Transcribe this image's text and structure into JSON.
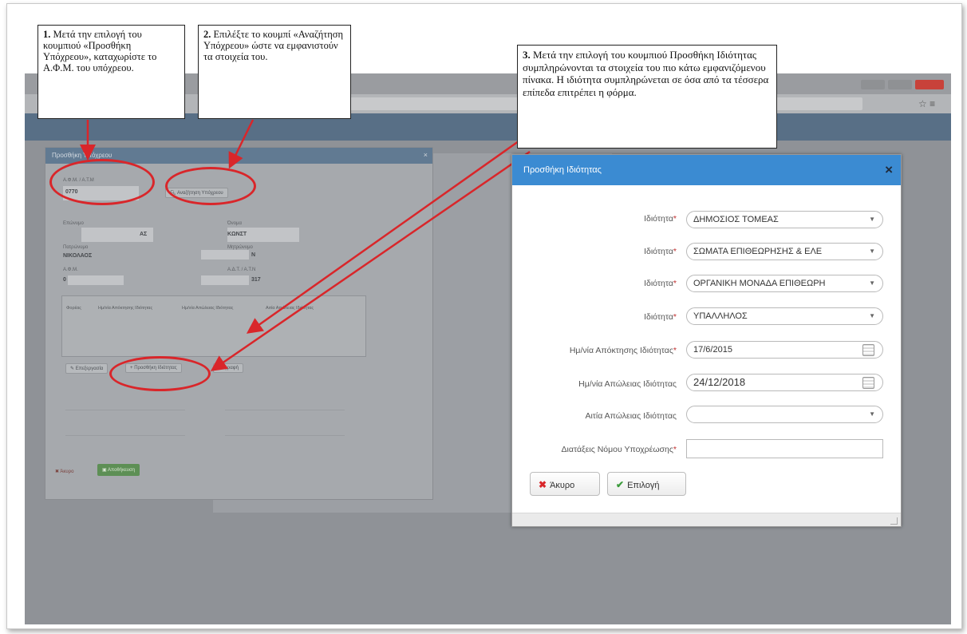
{
  "callouts": {
    "c1_num": "1.",
    "c1_text": "Μετά την επιλογή του κουμπιού «Προσθήκη Υπόχρεου», καταχωρίστε το Α.Φ.Μ. του υπόχρεου.",
    "c2_num": "2.",
    "c2_text": "Επιλέξτε το κουμπί «Αναζήτηση Υπόχρεου» ώστε να εμφανιστούν τα στοιχεία του.",
    "c3_num": "3.",
    "c3_text": "Μετά την επιλογή του κουμπιού Προσθήκη Ιδιότητας συμπληρώνονται τα στοιχεία του πιο κάτω εμφανιζόμενου πίνακα. Η ιδιότητα συμπληρώνεται σε όσα από τα τέσσερα επίπεδα επιτρέπει η φόρμα."
  },
  "left_modal": {
    "title": "Προσθήκη Υπόχρεου",
    "afm_label": "Α.Φ.Μ. / Α.Τ.Μ",
    "afm_value": "0770",
    "search_button": "Αναζήτηση Υπόχρεου",
    "surname_label": "Επώνυμο",
    "surname_value": "ΑΣ",
    "name_label": "Όνομα",
    "name_value": "ΚΩΝΣΤ",
    "father_label": "Πατρώνυμο",
    "father_value": "ΝΙΚΟΛΑΟΣ",
    "mother_label": "Μητρώνυμο",
    "mother_value": "Ν",
    "afm2_label": "Α.Φ.Μ.",
    "afm2_value": "0",
    "adt_label": "Α.Δ.Τ. / Α.Τ.Ν",
    "adt_value": "317",
    "table_headers": [
      "Φορέας",
      "Ημ/νία Απόκτησης Ιδιότητας",
      "Ημ/νία Απώλειας Ιδιότητας",
      "Αιτία Απώλειας Ιδιότητας"
    ],
    "edit_button": "Επεξεργασία",
    "add_property_button": "Προσθήκη Ιδιότητας",
    "delete_button": "Διαγραφή",
    "cancel_button": "Άκυρο",
    "save_button": "Αποθήκευση"
  },
  "right_modal": {
    "title": "Προσθήκη Ιδιότητας",
    "close_icon": "×",
    "rows": [
      {
        "label": "Ιδιότητα",
        "required": "*",
        "value": "ΔΗΜΟΣΙΟΣ ΤΟΜΕΑΣ",
        "kind": "select"
      },
      {
        "label": "Ιδιότητα",
        "required": "*",
        "value": "ΣΩΜΑΤΑ ΕΠΙΘΕΩΡΗΣΗΣ & ΕΛΕ",
        "kind": "select"
      },
      {
        "label": "Ιδιότητα",
        "required": "*",
        "value": "ΟΡΓΑΝΙΚΗ ΜΟΝΑΔΑ ΕΠΙΘΕΩΡΗ",
        "kind": "select"
      },
      {
        "label": "Ιδιότητα",
        "required": "*",
        "value": "ΥΠΑΛΛΗΛΟΣ",
        "kind": "select"
      },
      {
        "label": "Ημ/νία Απόκτησης Ιδιότητας",
        "required": "*",
        "value": "17/6/2015",
        "kind": "date"
      },
      {
        "label": "Ημ/νία Απώλειας Ιδιότητας",
        "required": "",
        "value": "24/12/2018",
        "kind": "date"
      },
      {
        "label": "Αιτία Απώλειας Ιδιότητας",
        "required": "",
        "value": "",
        "kind": "select"
      },
      {
        "label": "Διατάξεις Νόμου Υποχρέωσης",
        "required": "*",
        "value": "",
        "kind": "text"
      }
    ],
    "cancel_button": "Άκυρο",
    "select_button": "Επιλογή"
  },
  "colors": {
    "annotation_red": "#d9262a",
    "modal_header_blue": "#3b8bd2"
  }
}
